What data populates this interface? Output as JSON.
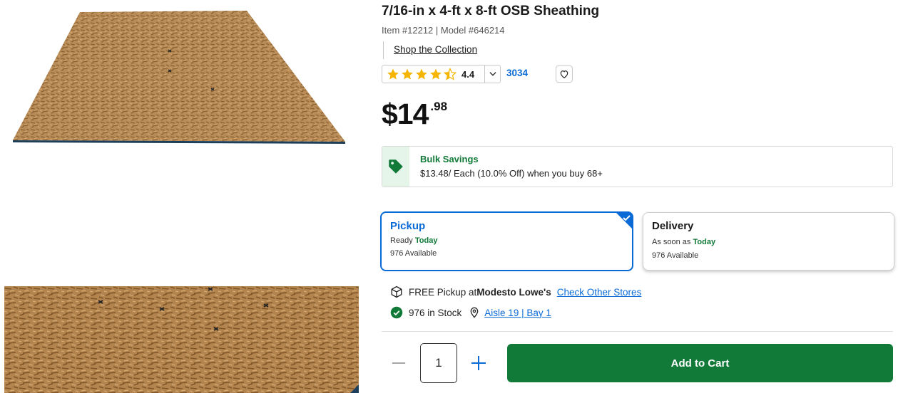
{
  "product": {
    "title": "7/16-in x 4-ft x 8-ft OSB Sheathing",
    "meta": "Item #12212 | Model #646214",
    "collection_link": "Shop the Collection"
  },
  "rating": {
    "value": "4.4",
    "stars": 4.4,
    "review_count": "3034",
    "star_color": "#f5b500"
  },
  "price": {
    "dollars": "$14",
    "cents": ".98"
  },
  "bulk": {
    "title": "Bulk Savings",
    "description": "$13.48/ Each (10.0% Off) when you buy 68+"
  },
  "fulfillment": {
    "pickup": {
      "title": "Pickup",
      "ready_prefix": "Ready ",
      "ready_day": "Today",
      "available": "976 Available",
      "selected": true
    },
    "delivery": {
      "title": "Delivery",
      "eta_prefix": "As soon as ",
      "eta_day": "Today",
      "available": "976 Available"
    }
  },
  "store": {
    "pickup_prefix": "FREE Pickup at ",
    "store_name": "Modesto Lowe's",
    "check_stores": "Check Other Stores",
    "stock": "976 in Stock",
    "location": "Aisle 19 | Bay 1"
  },
  "cart": {
    "quantity": "1",
    "add_label": "Add to Cart",
    "button_color": "#117a38"
  },
  "colors": {
    "accent_blue": "#0a6bd6",
    "brand_green": "#117a38"
  },
  "icons": [
    "star-icon",
    "chevron-down-icon",
    "heart-icon",
    "tag-icon",
    "checkmark-icon",
    "box-icon",
    "check-circle-icon",
    "location-pin-icon",
    "minus-icon",
    "plus-icon"
  ]
}
